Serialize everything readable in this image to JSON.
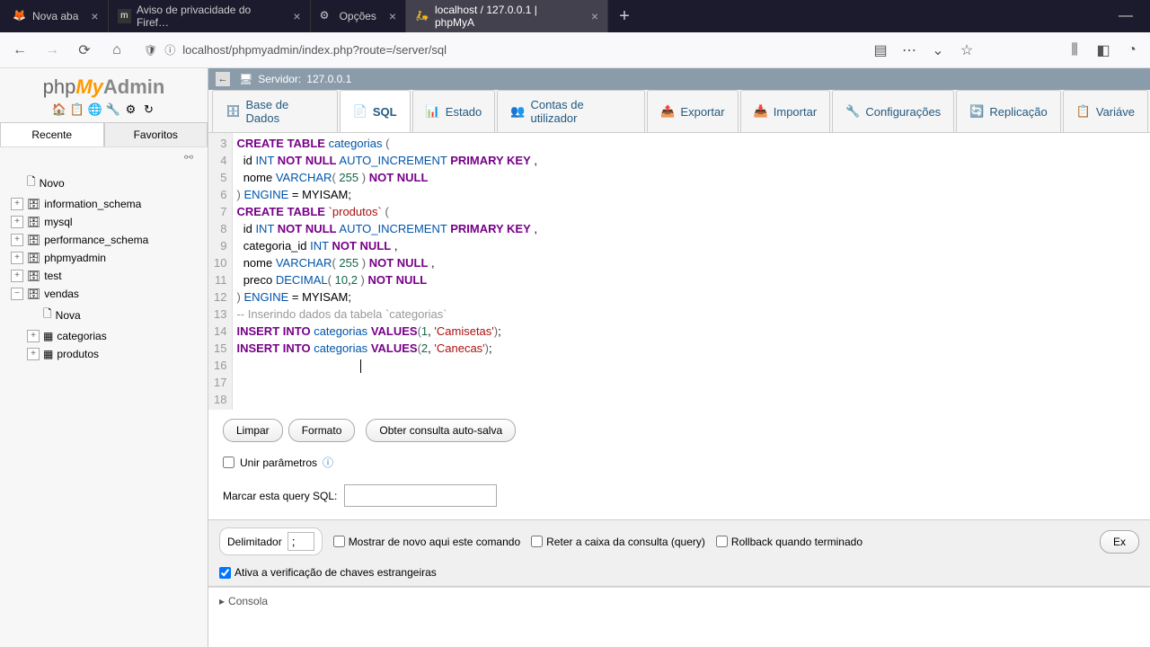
{
  "browser": {
    "tabs": [
      {
        "label": "Nova aba",
        "active": false
      },
      {
        "label": "Aviso de privacidade do Firef…",
        "active": false
      },
      {
        "label": "Opções",
        "active": false
      },
      {
        "label": "localhost / 127.0.0.1 | phpMyA",
        "active": true
      }
    ],
    "url": "localhost/phpmyadmin/index.php?route=/server/sql"
  },
  "logo": {
    "php": "php",
    "my": "My",
    "admin": "Admin"
  },
  "recent_tabs": {
    "recent": "Recente",
    "favorites": "Favoritos"
  },
  "tree": {
    "novo": "Novo",
    "dbs": [
      "information_schema",
      "mysql",
      "performance_schema",
      "phpmyadmin",
      "test",
      "vendas"
    ],
    "vendas_children": {
      "nova": "Nova",
      "categorias": "categorias",
      "produtos": "produtos"
    }
  },
  "breadcrumb": {
    "server_label": "Servidor:",
    "server_value": "127.0.0.1"
  },
  "main_tabs": {
    "database": "Base de Dados",
    "sql": "SQL",
    "status": "Estado",
    "users": "Contas de utilizador",
    "export": "Exportar",
    "import": "Importar",
    "settings": "Configurações",
    "replication": "Replicação",
    "variables": "Variáve"
  },
  "sql": {
    "line_start": 3,
    "lines": [
      {
        "n": 3,
        "tokens": [
          [
            "kw",
            "CREATE TABLE"
          ],
          [
            "",
            " "
          ],
          [
            "kw2",
            "categorias"
          ],
          [
            "",
            " "
          ],
          [
            "paren",
            "("
          ]
        ]
      },
      {
        "n": 4,
        "tokens": [
          [
            "",
            "  id "
          ],
          [
            "kw2",
            "INT"
          ],
          [
            "",
            " "
          ],
          [
            "kw",
            "NOT NULL"
          ],
          [
            "",
            " "
          ],
          [
            "kw2",
            "AUTO_INCREMENT"
          ],
          [
            "",
            " "
          ],
          [
            "kw",
            "PRIMARY KEY"
          ],
          [
            "",
            " ,"
          ]
        ]
      },
      {
        "n": 5,
        "tokens": [
          [
            "",
            "  nome "
          ],
          [
            "kw2",
            "VARCHAR"
          ],
          [
            "paren",
            "("
          ],
          [
            "",
            " "
          ],
          [
            "num",
            "255"
          ],
          [
            "",
            " "
          ],
          [
            "paren",
            ")"
          ],
          [
            "",
            " "
          ],
          [
            "kw",
            "NOT NULL"
          ]
        ]
      },
      {
        "n": 6,
        "tokens": [
          [
            "paren",
            ")"
          ],
          [
            "",
            " "
          ],
          [
            "kw2",
            "ENGINE"
          ],
          [
            "",
            " = MYISAM;"
          ]
        ]
      },
      {
        "n": 7,
        "tokens": [
          [
            "kw",
            "CREATE TABLE"
          ],
          [
            "",
            " "
          ],
          [
            "ident",
            "`produtos`"
          ],
          [
            "",
            " "
          ],
          [
            "paren",
            "("
          ]
        ]
      },
      {
        "n": 8,
        "tokens": [
          [
            "",
            "  id "
          ],
          [
            "kw2",
            "INT"
          ],
          [
            "",
            " "
          ],
          [
            "kw",
            "NOT NULL"
          ],
          [
            "",
            " "
          ],
          [
            "kw2",
            "AUTO_INCREMENT"
          ],
          [
            "",
            " "
          ],
          [
            "kw",
            "PRIMARY KEY"
          ],
          [
            "",
            " ,"
          ]
        ]
      },
      {
        "n": 9,
        "tokens": [
          [
            "",
            "  categoria_id "
          ],
          [
            "kw2",
            "INT"
          ],
          [
            "",
            " "
          ],
          [
            "kw",
            "NOT NULL"
          ],
          [
            "",
            " ,"
          ]
        ]
      },
      {
        "n": 10,
        "tokens": [
          [
            "",
            "  nome "
          ],
          [
            "kw2",
            "VARCHAR"
          ],
          [
            "paren",
            "("
          ],
          [
            "",
            " "
          ],
          [
            "num",
            "255"
          ],
          [
            "",
            " "
          ],
          [
            "paren",
            ")"
          ],
          [
            "",
            " "
          ],
          [
            "kw",
            "NOT NULL"
          ],
          [
            "",
            " ,"
          ]
        ]
      },
      {
        "n": 11,
        "tokens": [
          [
            "",
            "  preco "
          ],
          [
            "kw2",
            "DECIMAL"
          ],
          [
            "paren",
            "("
          ],
          [
            "",
            " "
          ],
          [
            "num",
            "10"
          ],
          [
            "",
            ","
          ],
          [
            "num",
            "2"
          ],
          [
            "",
            " "
          ],
          [
            "paren",
            ")"
          ],
          [
            "",
            " "
          ],
          [
            "kw",
            "NOT NULL"
          ]
        ]
      },
      {
        "n": 12,
        "tokens": [
          [
            "paren",
            ")"
          ],
          [
            "",
            " "
          ],
          [
            "kw2",
            "ENGINE"
          ],
          [
            "",
            " = MYISAM;"
          ]
        ]
      },
      {
        "n": 13,
        "tokens": [
          [
            "comment",
            "-- Inserindo dados da tabela `categorias`"
          ]
        ]
      },
      {
        "n": 14,
        "tokens": [
          [
            "kw",
            "INSERT INTO"
          ],
          [
            "",
            " "
          ],
          [
            "kw2",
            "categorias"
          ],
          [
            "",
            " "
          ],
          [
            "kw",
            "VALUES"
          ],
          [
            "paren",
            "("
          ],
          [
            "num",
            "1"
          ],
          [
            "",
            ", "
          ],
          [
            "str",
            "'Camisetas'"
          ],
          [
            "paren",
            ")"
          ],
          [
            "",
            ";"
          ]
        ]
      },
      {
        "n": 15,
        "tokens": [
          [
            "kw",
            "INSERT INTO"
          ],
          [
            "",
            " "
          ],
          [
            "kw2",
            "categorias"
          ],
          [
            "",
            " "
          ],
          [
            "kw",
            "VALUES"
          ],
          [
            "paren",
            "("
          ],
          [
            "num",
            "2"
          ],
          [
            "",
            ", "
          ],
          [
            "str",
            "'Canecas'"
          ],
          [
            "paren",
            ")"
          ],
          [
            "",
            ";"
          ]
        ]
      },
      {
        "n": 16,
        "tokens": []
      },
      {
        "n": 17,
        "tokens": []
      },
      {
        "n": 18,
        "tokens": []
      }
    ]
  },
  "buttons": {
    "clear": "Limpar",
    "format": "Formato",
    "autosave": "Obter consulta auto-salva"
  },
  "bind_params": "Unir parâmetros",
  "bookmark_label": "Marcar esta query SQL:",
  "footer": {
    "delimiter_label": "Delimitador",
    "delimiter_value": ";",
    "show_again": "Mostrar de novo aqui este comando",
    "retain": "Reter a caixa da consulta (query)",
    "rollback": "Rollback quando terminado",
    "fk_check": "Ativa a verificação de chaves estrangeiras",
    "execute": "Ex"
  },
  "console": "Consola"
}
